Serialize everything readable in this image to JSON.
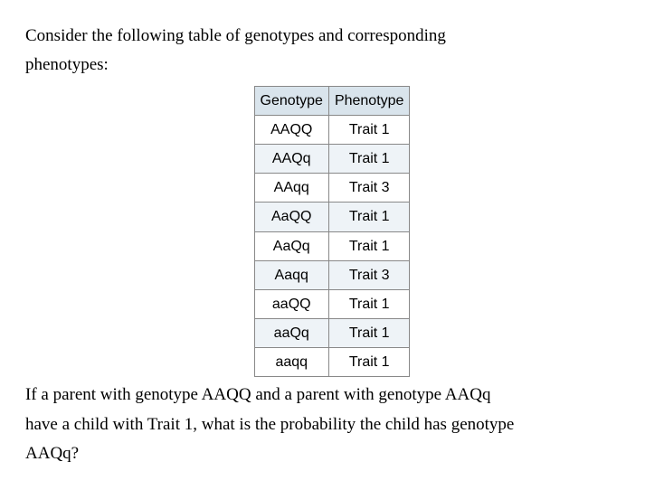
{
  "intro_line1": "Consider the following table of genotypes and corresponding",
  "intro_line2": "phenotypes:",
  "table": {
    "headers": [
      "Genotype",
      "Phenotype"
    ],
    "rows": [
      [
        "AAQQ",
        "Trait 1"
      ],
      [
        "AAQq",
        "Trait 1"
      ],
      [
        "AAqq",
        "Trait 3"
      ],
      [
        "AaQQ",
        "Trait 1"
      ],
      [
        "AaQq",
        "Trait 1"
      ],
      [
        "Aaqq",
        "Trait 3"
      ],
      [
        "aaQQ",
        "Trait 1"
      ],
      [
        "aaQq",
        "Trait 1"
      ],
      [
        "aaqq",
        "Trait 1"
      ]
    ]
  },
  "question_line1": "If a parent with genotype AAQQ and a parent with genotype AAQq",
  "question_line2": "have a child with Trait 1, what is the probability the child has genotype",
  "question_line3": "AAQq?"
}
